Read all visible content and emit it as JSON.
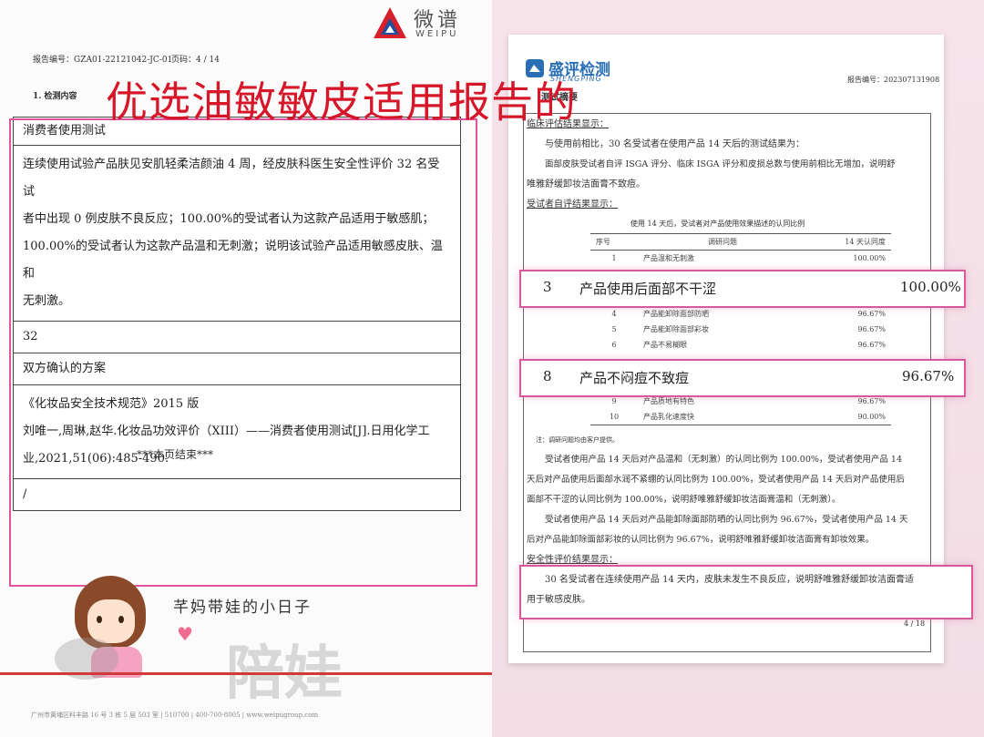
{
  "left": {
    "brand_cn": "微谱",
    "brand_en": "WEIPU",
    "report_no": "报告编号：GZA01-22121042-JC-01",
    "page": "页码：4 / 14",
    "section": "1. 检测内容",
    "overlay_title": "优选油敏敏皮适用报告的",
    "table_rows": [
      "消费者使用测试",
      "连续使用试验产品肤见安肌轻柔洁颜油 4 周，经皮肤科医生安全性评价 32 名受试",
      "者中出现 0 例皮肤不良反应；100.00%的受试者认为这款产品适用于敏感肌；",
      "100.00%的受试者认为这款产品温和无刺激；说明该试验产品适用敏感皮肤、温和",
      "无刺激。",
      "32",
      "双方确认的方案",
      "《化妆品安全技术规范》2015 版",
      "刘唯一,周琳,赵华.化妆品功效评价（XIII）——消费者使用测试[J].日用化学工",
      "业,2021,51(06):485-490.",
      "/"
    ],
    "end_text": "***本页结束***",
    "watermark_caption": "芊妈带娃的小日子",
    "watermark_big": "陪娃",
    "footer": "广州市黄埔区科丰路 16 号 3 栋 5 层 503 室 | 510700 | 400-700-8005 | www.weipugroup.com"
  },
  "right": {
    "logo_cn": "盛评检测",
    "logo_en": "SHENGPING",
    "report_no": "报告编号：2023071319​08",
    "section_title": "测试摘要",
    "clinical_heading": "临床评估结果显示：",
    "clinical_p1": "与使用前相比，30 名受试者在使用产品 14 天后的测试结果为：",
    "clinical_p2a": "面部皮肤受试者自评 ISGA 评分、临床 ISGA 评分和皮损总数与使用前相比无增加，说明舒",
    "clinical_p2b": "唯雅舒缓卸妆洁面膏不致痘。",
    "self_heading": "受试者自评结果显示：",
    "table_caption": "使用 14 天后，受试者对产品使用效果描述的认同比例",
    "table_headers": [
      "序号",
      "调研问题",
      "14 天认同度"
    ],
    "rows": [
      {
        "no": "1",
        "q": "产品温和无刺激",
        "v": "100.00%"
      },
      {
        "no": "4",
        "q": "产品能卸除面部防晒",
        "v": "96.67%"
      },
      {
        "no": "5",
        "q": "产品能卸除面部彩妆",
        "v": "96.67%"
      },
      {
        "no": "6",
        "q": "产品不易糊眼",
        "v": "96.67%"
      },
      {
        "no": "9",
        "q": "产品质地有特色",
        "v": "96.67%"
      },
      {
        "no": "10",
        "q": "产品乳化速度快",
        "v": "90.00%"
      }
    ],
    "highlight1": {
      "no": "3",
      "q": "产品使用后面部不干涩",
      "v": "100.00%"
    },
    "highlight2": {
      "no": "8",
      "q": "产品不闷痘不致痘",
      "v": "96.67%"
    },
    "note": "注：调研问题均由客户提供。",
    "para1a": "受试者使用产品 14 天后对产品温和（无刺激）的认同比例为 100.00%，受试者使用产品 14",
    "para1b": "天后对产品使用后面部水润不紧绷的认同比例为 100.00%，受试者使用产品 14 天后对产品使用后",
    "para1c": "面部不干涩的认同比例为 100.00%，说明舒唯雅舒缓卸妆洁面膏温和（无刺激）。",
    "para2a": "受试者使用产品 14 天后对产品能卸除面部防晒的认同比例为 96.67%，受试者使用产品 14 天",
    "para2b": "后对产品能卸除面部彩妆的认同比例为 96.67%，说明舒唯雅舒缓卸妆洁面膏有卸妆效果。",
    "safety_heading": "安全性评价结果显示：",
    "safety_a": "30 名受试者在连续使用产品 14 天内，皮肤未发生不良反应，说明舒唯雅舒缓卸妆洁面膏适",
    "safety_b": "用于敏感皮肤。",
    "page_no": "4 / 18"
  }
}
